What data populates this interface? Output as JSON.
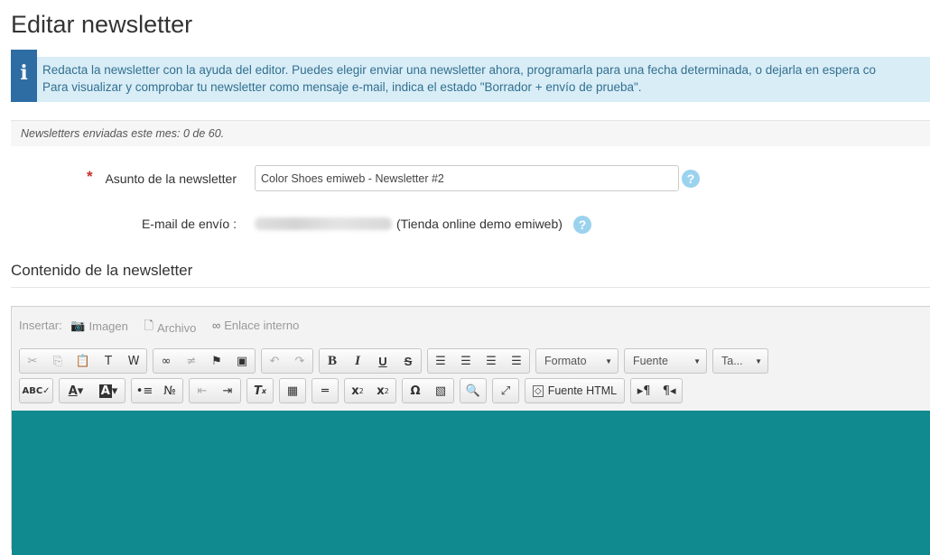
{
  "page_title": "Editar newsletter",
  "info": {
    "icon": "info-icon",
    "line1": "Redacta la newsletter con la ayuda del editor. Puedes elegir enviar una newsletter ahora, programarla para una fecha determinada, o dejarla en espera co",
    "line2": "Para visualizar y comprobar tu newsletter como mensaje e-mail, indica el estado \"Borrador + envío de prueba\".",
    "color_bg": "#d9edf7"
  },
  "stats": {
    "text": "Newsletters enviadas este mes: 0 de 60."
  },
  "form": {
    "required_mark": "*",
    "subject_label": "Asunto de la newsletter",
    "subject_value": "Color Shoes emiweb - Newsletter #2",
    "email_label": "E-mail de envío :",
    "email_store": "(Tienda online demo emiweb)",
    "help_glyph": "?"
  },
  "content_section": {
    "title": "Contenido de la newsletter"
  },
  "editor": {
    "insert": {
      "label": "Insertar:",
      "image": "Imagen",
      "file": "Archivo",
      "internal_link": "Enlace interno"
    },
    "toolbar": {
      "format_label": "Formato",
      "font_label": "Fuente",
      "size_label": "Ta...",
      "source_label": "Fuente HTML"
    },
    "canvas_color": "#118a8f"
  }
}
